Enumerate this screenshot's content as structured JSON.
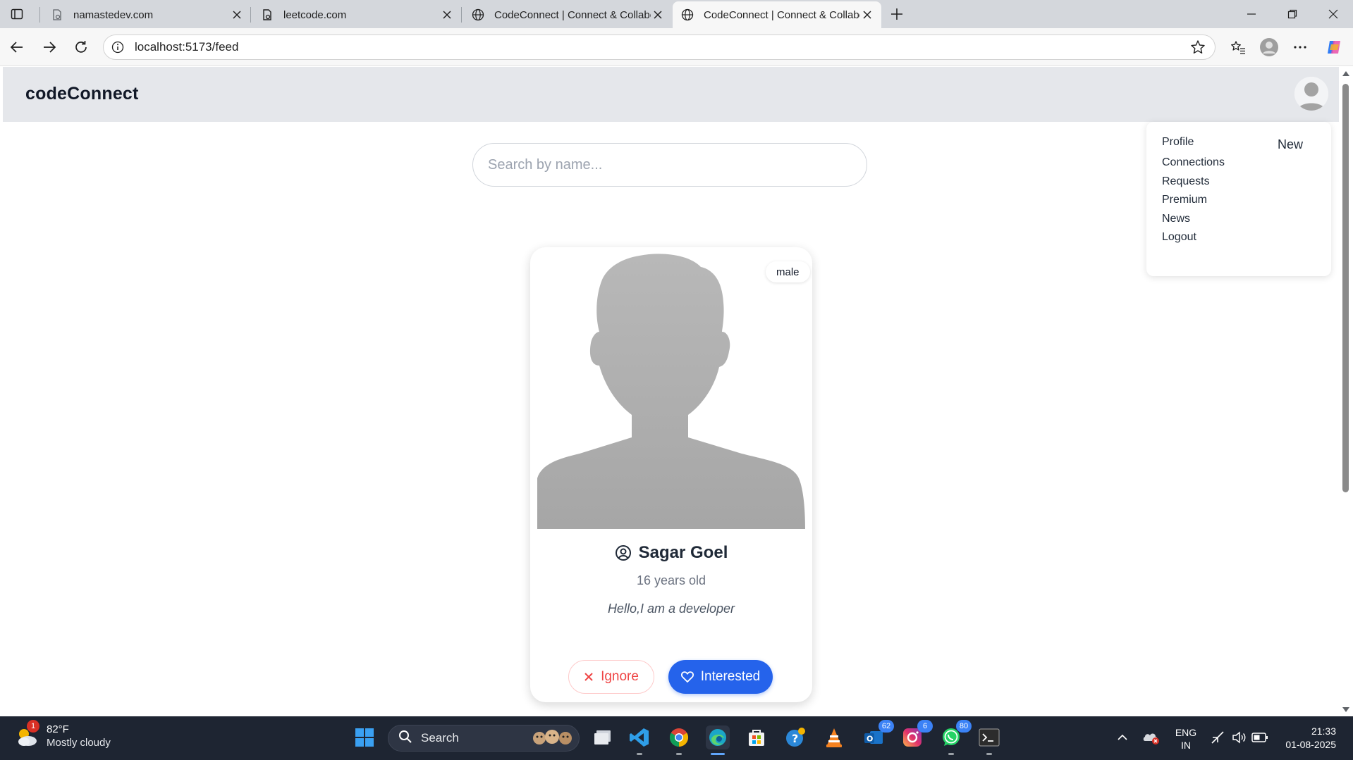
{
  "browser": {
    "tabs": [
      {
        "title": "namastedev.com",
        "active": false
      },
      {
        "title": "leetcode.com",
        "active": false
      },
      {
        "title": "CodeConnect | Connect & Collaborate",
        "active": false
      },
      {
        "title": "CodeConnect | Connect & Collaborate",
        "active": true
      }
    ],
    "url": "localhost:5173/feed"
  },
  "app": {
    "brand": "codeConnect",
    "search": {
      "placeholder": "Search by name...",
      "value": ""
    },
    "menu": {
      "items": [
        "Profile",
        "Connections",
        "Requests",
        "Premium",
        "News",
        "Logout"
      ],
      "badge": "New"
    },
    "card": {
      "gender": "male",
      "name": "Sagar Goel",
      "age": "16 years old",
      "about": "Hello,I am a developer",
      "ignore_label": "Ignore",
      "interested_label": "Interested"
    },
    "colors": {
      "primary": "#2563eb",
      "danger": "#ef4444",
      "header_bg": "#e5e7eb"
    }
  },
  "taskbar": {
    "weather": {
      "temp": "82°F",
      "condition": "Mostly cloudy",
      "alerts": "1"
    },
    "search_label": "Search",
    "badges": {
      "outlook": "62",
      "instagram": "6",
      "whatsapp": "80"
    },
    "language": {
      "line1": "ENG",
      "line2": "IN"
    },
    "time": "21:33",
    "date": "01-08-2025"
  }
}
